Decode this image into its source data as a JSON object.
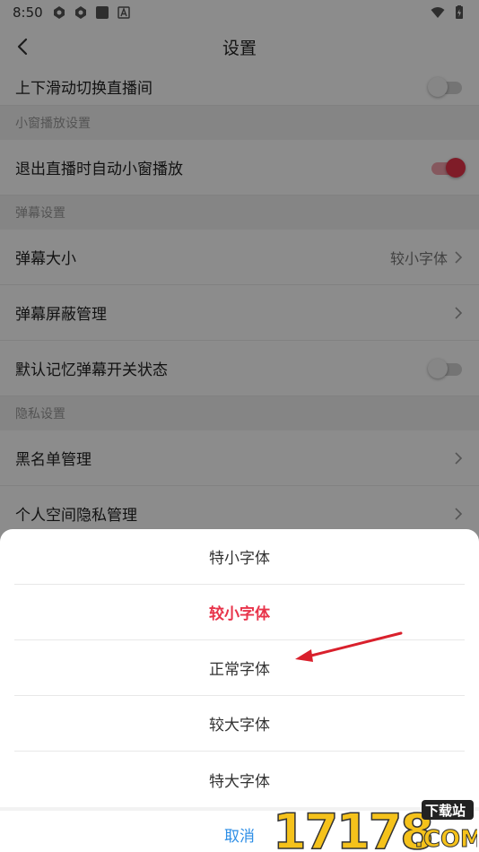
{
  "status_bar": {
    "time": "8:50"
  },
  "header": {
    "title": "设置"
  },
  "settings": {
    "row_swipe": {
      "label": "上下滑动切换直播间",
      "toggle": "off"
    },
    "section_mini": "小窗播放设置",
    "row_auto_mini": {
      "label": "退出直播时自动小窗播放",
      "toggle": "on"
    },
    "section_danmaku": "弹幕设置",
    "row_danmaku_size": {
      "label": "弹幕大小",
      "value": "较小字体"
    },
    "row_danmaku_block": {
      "label": "弹幕屏蔽管理"
    },
    "row_danmaku_memory": {
      "label": "默认记忆弹幕开关状态",
      "toggle": "off"
    },
    "section_privacy": "隐私设置",
    "row_blacklist": {
      "label": "黑名单管理"
    },
    "row_space_privacy": {
      "label": "个人空间隐私管理"
    }
  },
  "sheet": {
    "options": [
      "特小字体",
      "较小字体",
      "正常字体",
      "较大字体",
      "特大字体"
    ],
    "selected": "较小字体",
    "cancel": "取消"
  },
  "colors": {
    "accent": "#e8334a",
    "link": "#2d8ee6",
    "annotation_arrow": "#d9202c"
  },
  "watermark": {
    "text": "17178",
    "badge": "下载站",
    "suffix": ".COM"
  }
}
